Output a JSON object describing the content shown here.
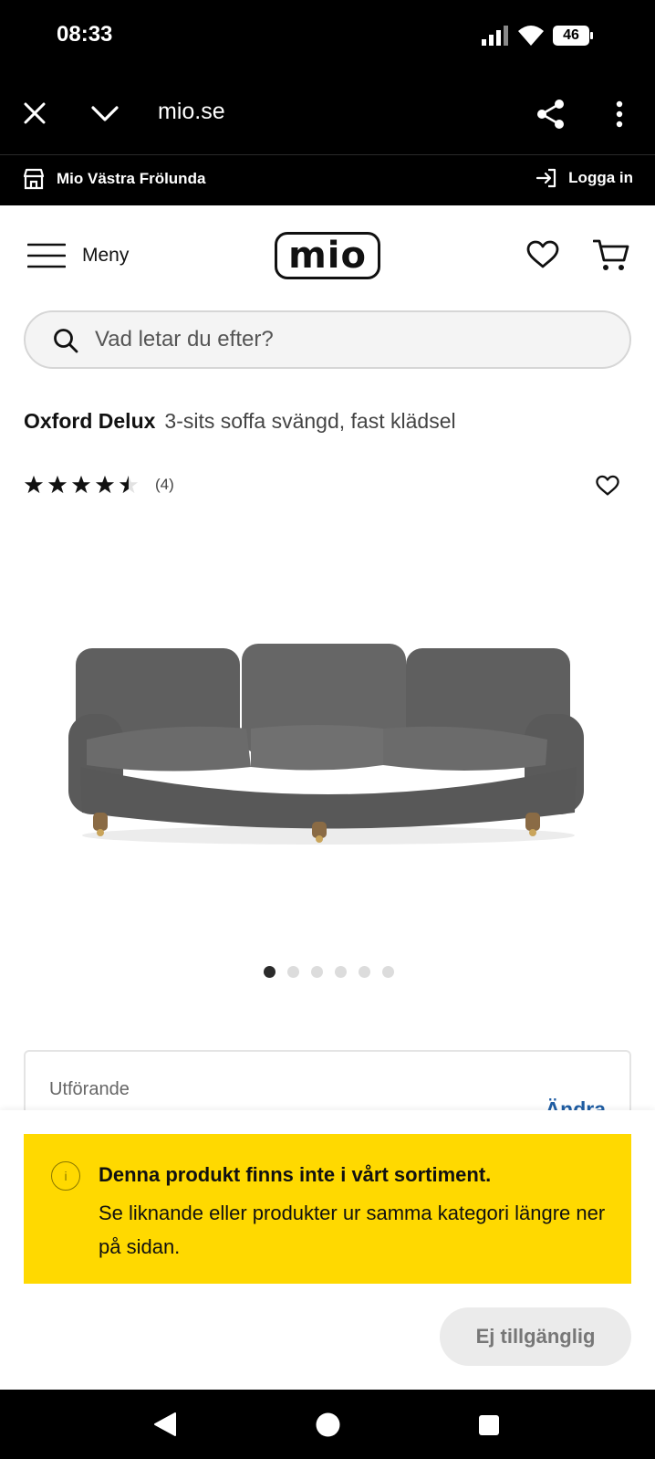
{
  "status_bar": {
    "time": "08:33",
    "battery": "46"
  },
  "browser": {
    "url": "mio.se",
    "icons": [
      "close-icon",
      "chevron-down-icon",
      "share-icon",
      "more-vertical-icon"
    ]
  },
  "store_bar": {
    "store": "Mio Västra Frölunda",
    "login": "Logga in"
  },
  "header": {
    "menu_label": "Meny",
    "logo": "mio"
  },
  "search": {
    "placeholder": "Vad letar du efter?"
  },
  "product": {
    "brand": "Oxford Delux",
    "description": "3-sits soffa svängd, fast klädsel",
    "rating": 4.5,
    "review_count": "(4)",
    "image_count": 6,
    "active_image": 1,
    "config_label": "Utförande",
    "config_action": "Ändra"
  },
  "notice": {
    "title": "Denna produkt finns inte i vårt sortiment.",
    "body": "Se liknande eller produkter ur samma kategori längre ner på sidan.",
    "icon_text": "i"
  },
  "action_button": "Ej tillgänglig",
  "colors": {
    "accent_yellow": "#ffd900",
    "link_blue": "#1f5da3"
  }
}
